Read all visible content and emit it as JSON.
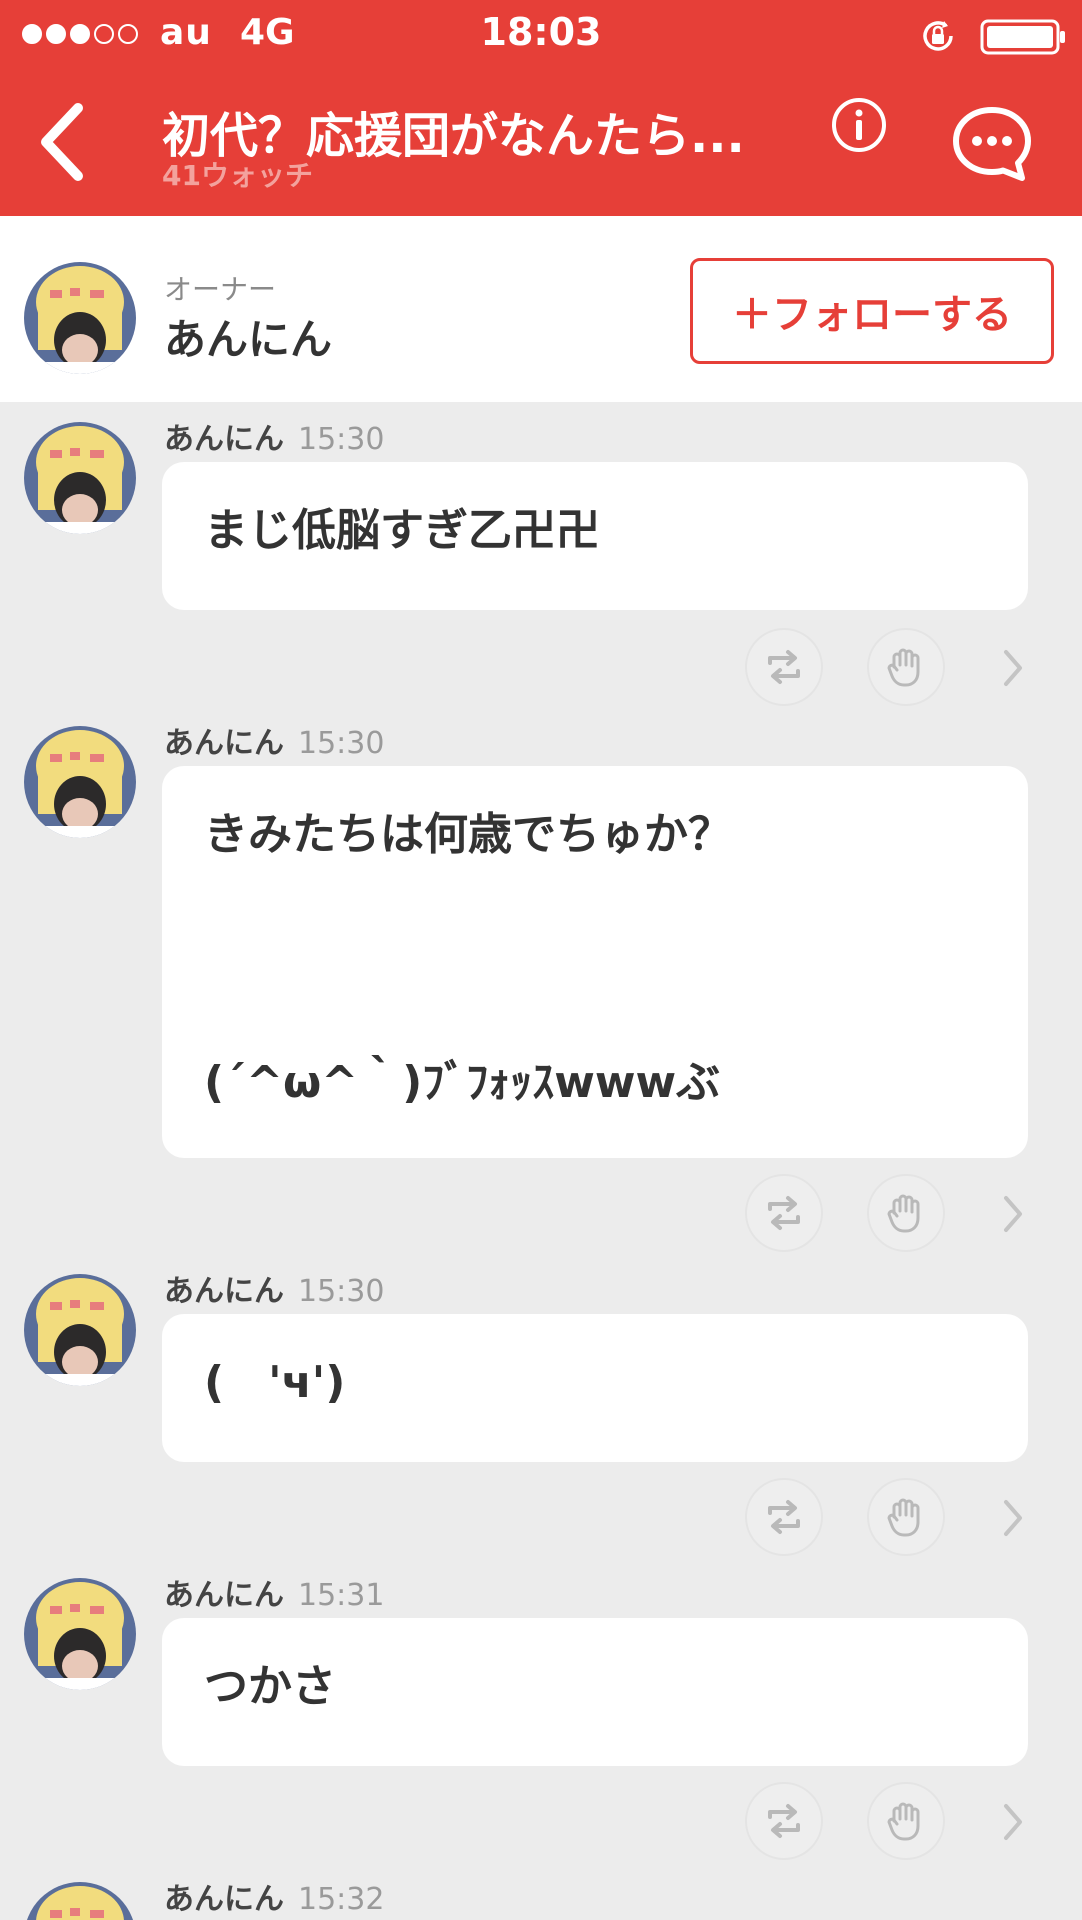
{
  "status_bar": {
    "carrier": "au",
    "network": "4G",
    "time": "18:03"
  },
  "header": {
    "title": "初代？応援団がなんたら...",
    "subtitle": "41ウォッチ"
  },
  "owner": {
    "label": "オーナー",
    "name": "あんにん",
    "follow_label": "＋フォローする"
  },
  "messages": [
    {
      "name": "あんにん",
      "time": "15:30",
      "text": "まじ低脳すぎ乙卍卍"
    },
    {
      "name": "あんにん",
      "time": "15:30",
      "text": "きみたちは何歳でちゅか？\n\n\n\n  (´^ω^｀)ﾌﾞﾌｫｯｽwwwぶ"
    },
    {
      "name": "あんにん",
      "time": "15:30",
      "text": "(　'ч')"
    },
    {
      "name": "あんにん",
      "time": "15:31",
      "text": "つかさ"
    },
    {
      "name": "あんにん",
      "time": "15:32",
      "text": ""
    }
  ],
  "colors": {
    "accent": "#e63f38",
    "background": "#ececec"
  },
  "icons": [
    "signal-icon",
    "rotation-lock-icon",
    "battery-icon",
    "back-icon",
    "info-icon",
    "chat-bubble-icon",
    "repost-icon",
    "clap-hand-icon",
    "chevron-right-icon"
  ]
}
